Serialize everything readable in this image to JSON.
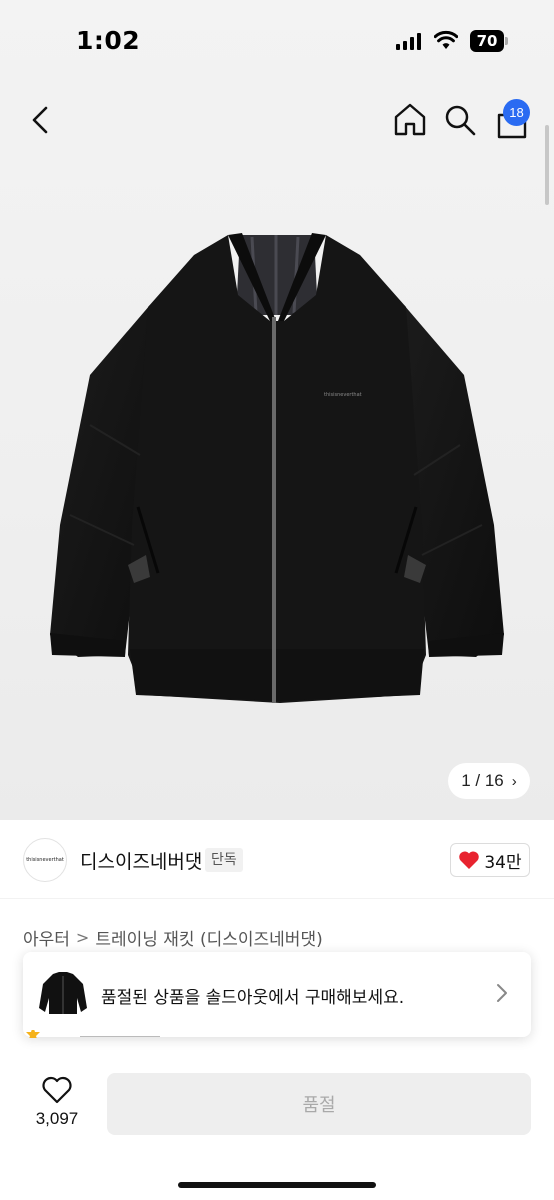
{
  "status_bar": {
    "time": "1:02",
    "battery": "70"
  },
  "nav": {
    "back_icon": "chevron-left-icon",
    "home_icon": "home-icon",
    "search_icon": "search-icon",
    "cart_icon": "shopping-bag-icon",
    "cart_badge": "18"
  },
  "gallery": {
    "position": "1 / 16",
    "chevron": "›",
    "jacket_logo": "thisisneverthat"
  },
  "brand": {
    "logo_text": "thisisneverthat",
    "name": "디스이즈네버댓",
    "tag": "단독",
    "likes": "34만"
  },
  "breadcrumb": {
    "category": "아우터",
    "separator": ">",
    "product": "트레이닝 재킷 (디스이즈네버댓)"
  },
  "soldout_banner": {
    "text": "품절된 상품을 솔드아웃에서 구매해보세요."
  },
  "bottom_bar": {
    "wish_count": "3,097",
    "buy_button": "품절"
  },
  "colors": {
    "accent_badge": "#2a6bf2",
    "like_heart": "#e8232f",
    "disabled_button": "#eeeeee"
  }
}
